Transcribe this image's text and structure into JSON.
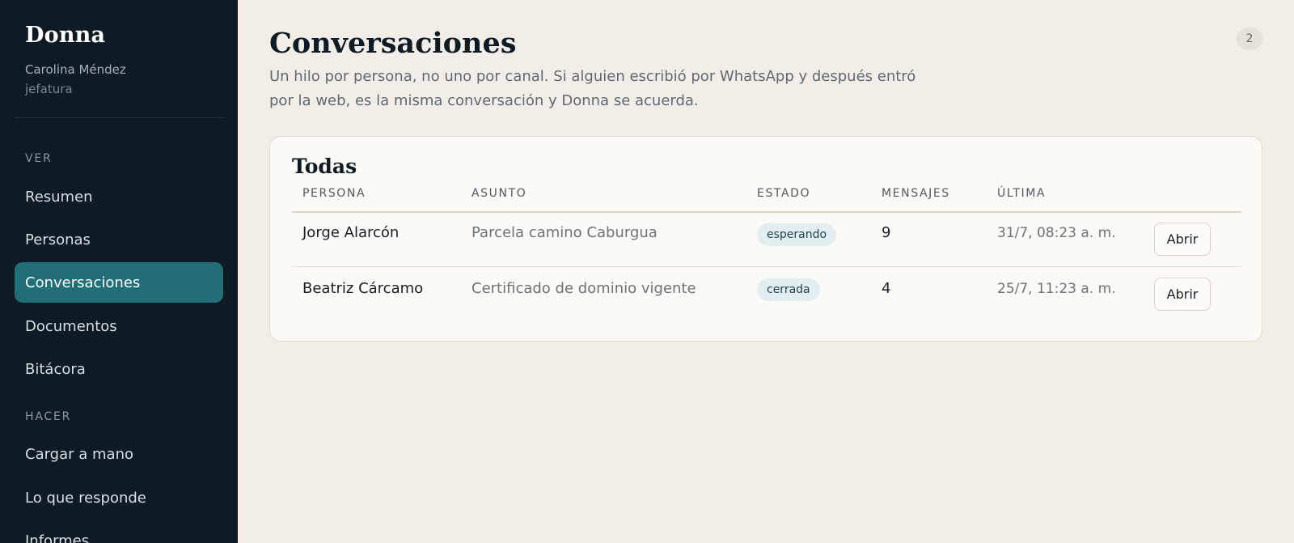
{
  "sidebar": {
    "brand": "Donna",
    "user_name": "Carolina Méndez",
    "user_role": "jefatura",
    "sections": [
      {
        "label": "VER",
        "items": [
          {
            "label": "Resumen"
          },
          {
            "label": "Personas"
          },
          {
            "label": "Conversaciones",
            "active": true
          },
          {
            "label": "Documentos"
          },
          {
            "label": "Bitácora"
          }
        ]
      },
      {
        "label": "HACER",
        "items": [
          {
            "label": "Cargar a mano"
          },
          {
            "label": "Lo que responde"
          },
          {
            "label": "Informes"
          }
        ]
      }
    ]
  },
  "main": {
    "title": "Conversaciones",
    "description": "Un hilo por persona, no uno por canal. Si alguien escribió por WhatsApp y después entró por la web, es la misma conversación y Donna se acuerda.",
    "count_badge": "2",
    "card": {
      "title": "Todas",
      "columns": [
        "PERSONA",
        "ASUNTO",
        "ESTADO",
        "MENSAJES",
        "ÚLTIMA"
      ],
      "rows": [
        {
          "persona": "Jorge Alarcón",
          "asunto": "Parcela camino Caburgua",
          "estado": "esperando",
          "mensajes": "9",
          "ultima": "31/7, 08:23 a. m.",
          "action": "Abrir"
        },
        {
          "persona": "Beatriz Cárcamo",
          "asunto": "Certificado de dominio vigente",
          "estado": "cerrada",
          "mensajes": "4",
          "ultima": "25/7, 11:23 a. m.",
          "action": "Abrir"
        }
      ]
    }
  },
  "colors": {
    "sidebar_bg": "#0e1b24",
    "active_item": "#226e78",
    "page_bg": "#f2ede6",
    "card_bg": "#fbfaf6",
    "status_pill_bg": "#e3eef1"
  }
}
